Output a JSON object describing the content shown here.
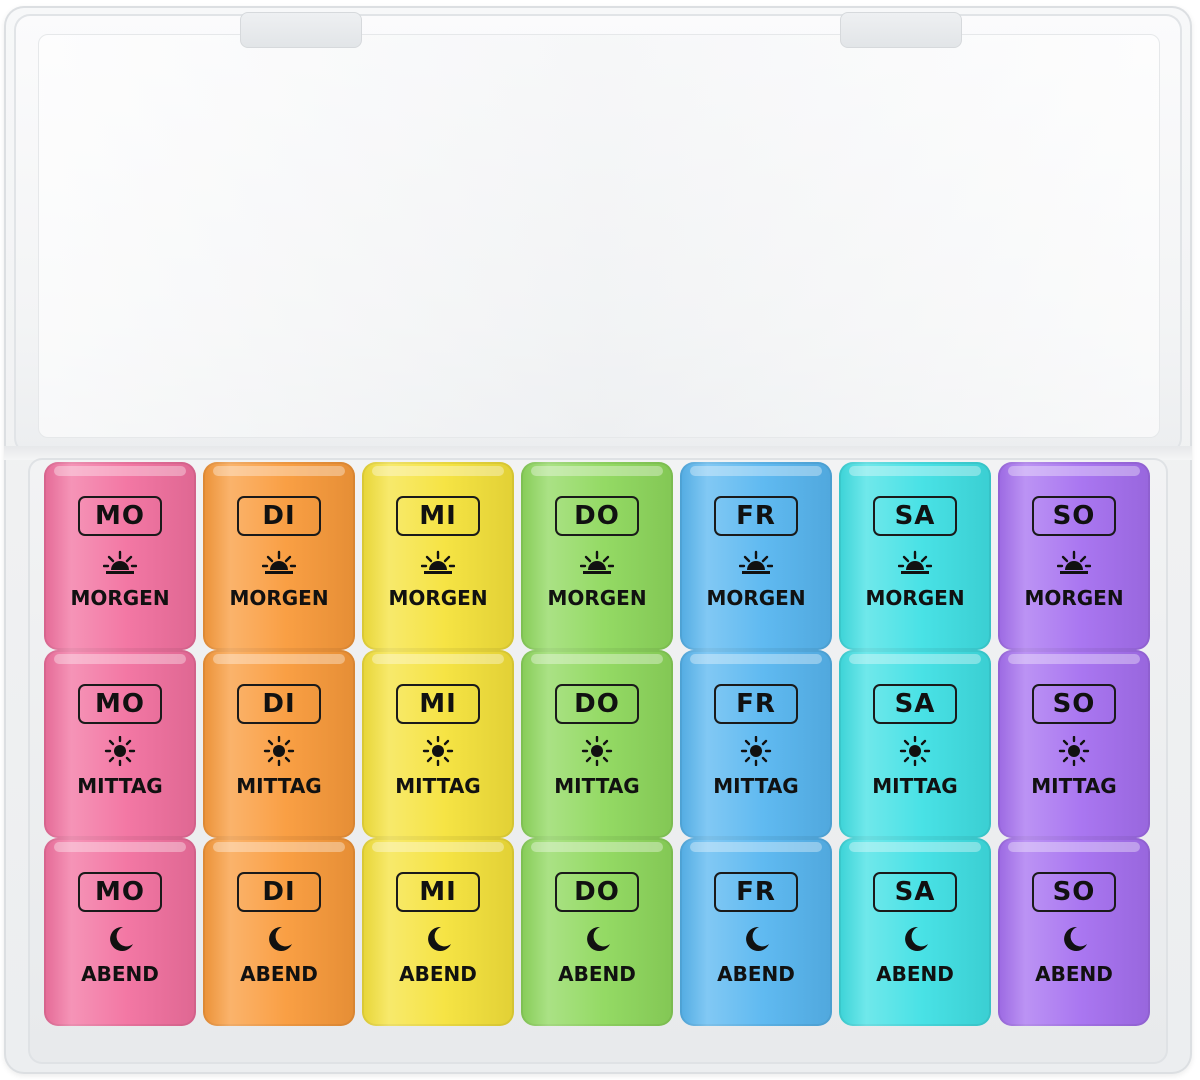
{
  "colors": {
    "MO": "#f2709f",
    "DI": "#f99a3a",
    "MI": "#f5e23a",
    "DO": "#8ed85c",
    "FR": "#57b6f0",
    "SA": "#3fe0e4",
    "SO": "#a56ff0"
  },
  "days": [
    "MO",
    "DI",
    "MI",
    "DO",
    "FR",
    "SA",
    "SO"
  ],
  "rows": [
    {
      "label": "MORGEN",
      "icon": "sunrise-icon"
    },
    {
      "label": "MITTAG",
      "icon": "sun-icon"
    },
    {
      "label": "ABEND",
      "icon": "moon-icon"
    }
  ]
}
